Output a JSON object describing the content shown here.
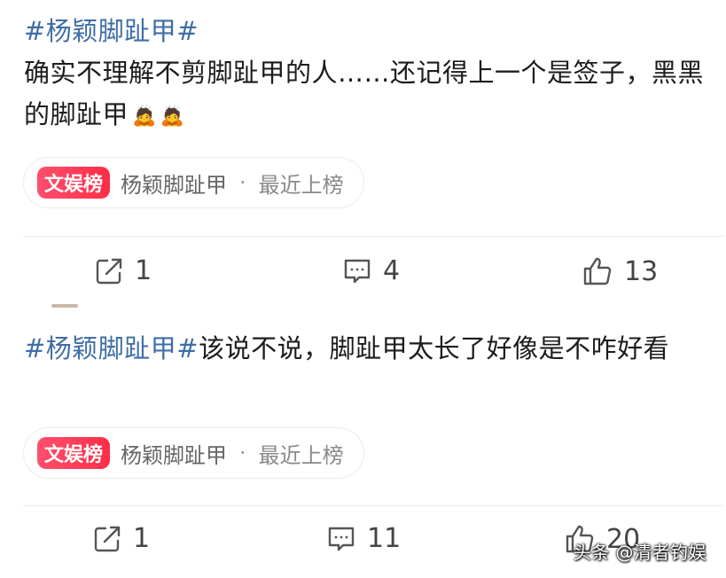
{
  "posts": [
    {
      "topic": "#杨颖脚趾甲#",
      "body": "确实不理解不剪脚趾甲的人……还记得上一个是签子，黑黑的脚趾甲",
      "emoji": "🙇",
      "chip": {
        "badge": "文娱榜",
        "topic": "杨颖脚趾甲",
        "separator": "·",
        "status": "最近上榜"
      },
      "actions": {
        "share_count": "1",
        "comment_count": "4",
        "like_count": "13"
      }
    },
    {
      "topic": "#杨颖脚趾甲#",
      "body": "该说不说，脚趾甲太长了好像是不咋好看",
      "chip": {
        "badge": "文娱榜",
        "topic": "杨颖脚趾甲",
        "separator": "·",
        "status": "最近上榜"
      },
      "actions": {
        "share_count": "1",
        "comment_count": "11",
        "like_count": "20"
      }
    }
  ],
  "watermark": "头条 @清者钓娱",
  "colors": {
    "topic": "#3f6ea7",
    "badge": "#ff3b55"
  }
}
